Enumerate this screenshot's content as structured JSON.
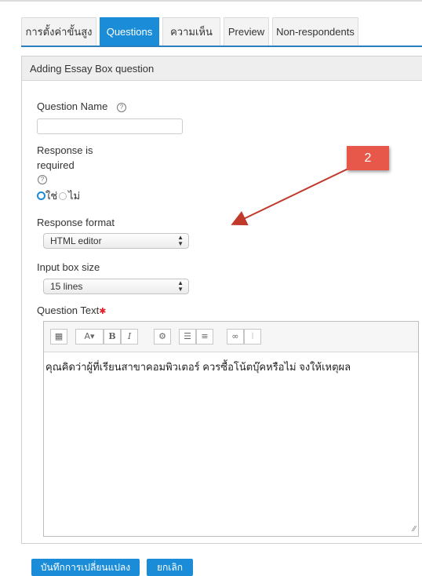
{
  "tabs": [
    {
      "label": "การตั้งค่าขั้นสูง"
    },
    {
      "label": "Questions"
    },
    {
      "label": "ความเห็น"
    },
    {
      "label": "Preview"
    },
    {
      "label": "Non-respondents"
    }
  ],
  "panel": {
    "title": "Adding Essay Box question"
  },
  "form": {
    "question_name_label": "Question Name",
    "question_name_value": "",
    "response_required_line1": "Response is",
    "response_required_line2": "required",
    "yes_label": "ใช่",
    "no_label": "ไม่",
    "response_format_label": "Response format",
    "response_format_value": "HTML editor",
    "input_box_size_label": "Input box size",
    "input_box_size_value": "15 lines",
    "question_text_label": "Question Text",
    "required_mark": "✱",
    "question_text_value": "คุณคิดว่าผู้ที่เรียนสาขาคอมพิวเตอร์ ควรซื้อโน้ตบุ๊คหรือไม่ จงให้เหตุผล"
  },
  "toolbar": {
    "bold_label": "B",
    "italic_label": "I"
  },
  "buttons": {
    "save_label": "บันทึกการเปลี่ยนแปลง",
    "cancel_label": "ยกเลิก"
  },
  "annotation": {
    "number": "2",
    "color": "#e8584a"
  },
  "colors": {
    "accent": "#1a8cd8"
  }
}
